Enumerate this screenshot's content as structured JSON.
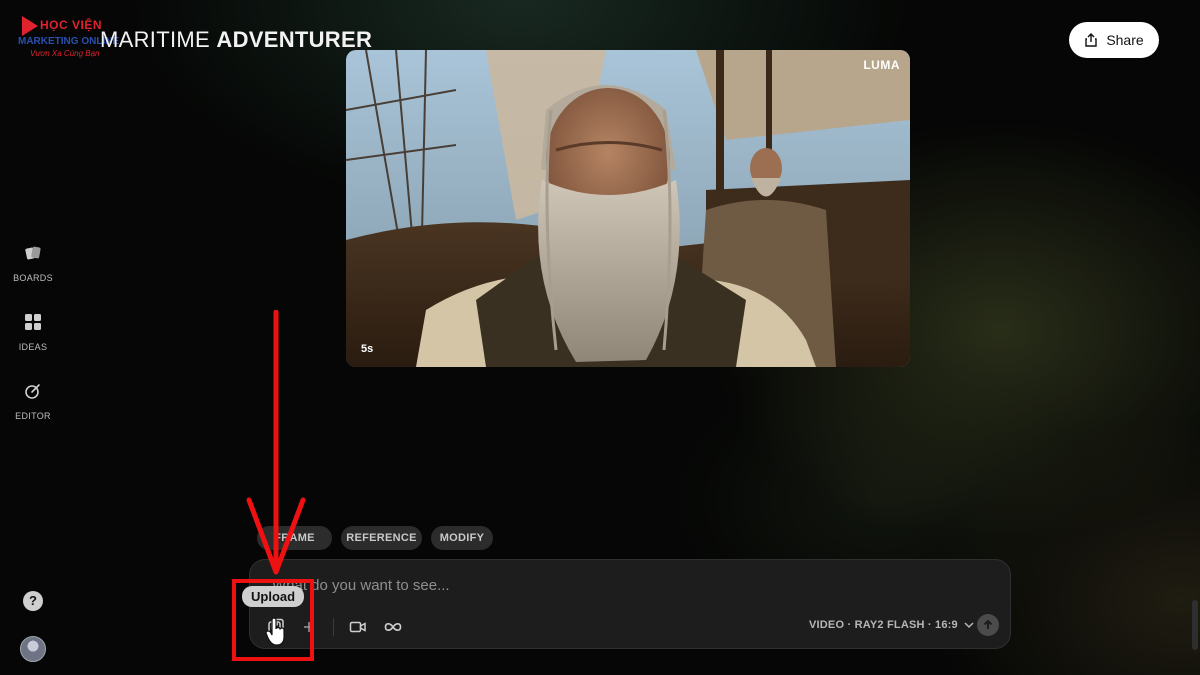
{
  "watermark": {
    "line1": "HỌC VIỆN",
    "line2": "MARKETING ONLINE",
    "line3": "Vươn Xa Cùng Bạn"
  },
  "board": {
    "title_part1": "MARITIME ",
    "title_part2": "ADVENTURER"
  },
  "header": {
    "share_label": "Share"
  },
  "sidebar": {
    "items": [
      {
        "label": "BOARDS",
        "icon": "boards-icon"
      },
      {
        "label": "IDEAS",
        "icon": "ideas-icon"
      },
      {
        "label": "EDITOR",
        "icon": "editor-icon"
      }
    ],
    "help_label": "?"
  },
  "video": {
    "brand": "LUMA",
    "duration": "5s"
  },
  "modes": {
    "frame": "FRAME",
    "reference": "REFERENCE",
    "modify": "MODIFY"
  },
  "composer": {
    "placeholder": "What do you want to see...",
    "tooltip": "Upload",
    "settings": "VIDEO · RAY2 FLASH · 16:9"
  },
  "colors": {
    "highlight": "#ee1111",
    "share_bg": "#ffffff",
    "background": "#050605"
  }
}
